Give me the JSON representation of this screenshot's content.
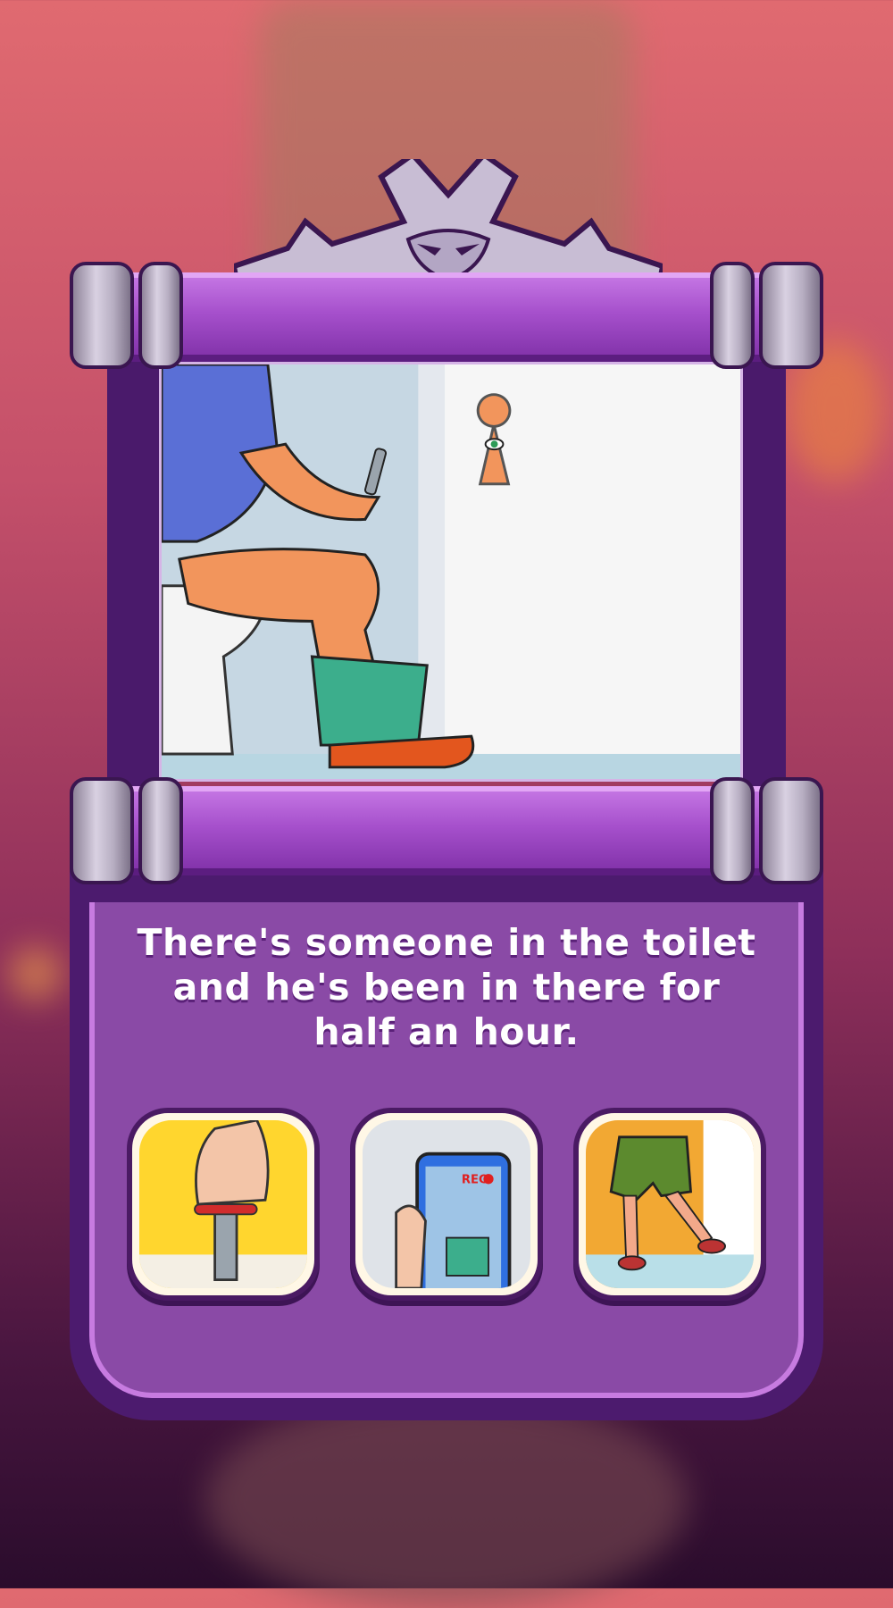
{
  "question": {
    "line1": "There's someone in the toilet",
    "line2": "and he's been in there for",
    "line3": "half an hour."
  },
  "options": [
    {
      "id": "water-valve",
      "icon": "water-valve-icon"
    },
    {
      "id": "phone-record",
      "icon": "phone-record-icon",
      "badge": "REC"
    },
    {
      "id": "walk-away",
      "icon": "walking-legs-icon"
    }
  ],
  "colors": {
    "panel_purple": "#8a4aa6",
    "frame_dark": "#4c1b6e",
    "accent_light": "#c77be0"
  }
}
